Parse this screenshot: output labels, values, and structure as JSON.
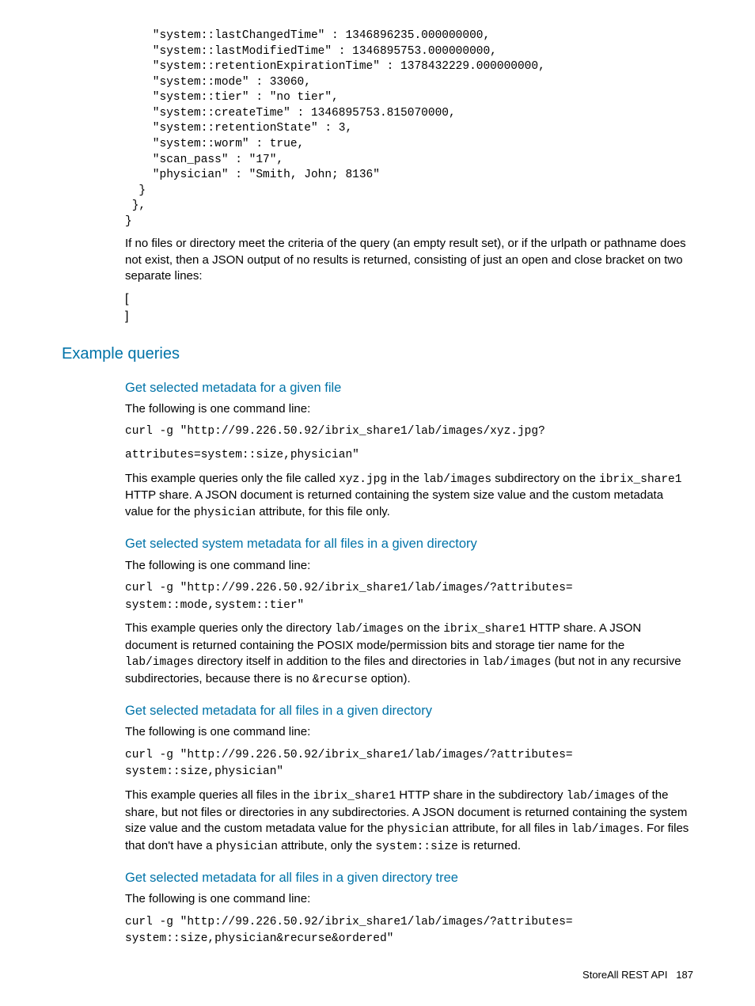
{
  "code_top": "    \"system::lastChangedTime\" : 1346896235.000000000,\n    \"system::lastModifiedTime\" : 1346895753.000000000,\n    \"system::retentionExpirationTime\" : 1378432229.000000000,\n    \"system::mode\" : 33060,\n    \"system::tier\" : \"no tier\",\n    \"system::createTime\" : 1346895753.815070000,\n    \"system::retentionState\" : 3,\n    \"system::worm\" : true,\n    \"scan_pass\" : \"17\",\n    \"physician\" : \"Smith, John; 8136\"\n  }\n },\n}",
  "para_empty": "If no files or directory meet the criteria of the query (an empty result set), or if the urlpath or pathname does not exist, then a JSON output of no results is returned, consisting of just an open and close bracket on two separate lines:",
  "bracket_open": "[",
  "bracket_close": "]",
  "section_examples": "Example queries",
  "ex1": {
    "title": "Get selected metadata for a given file",
    "intro": "The following is one command line:",
    "cmd1": "curl -g \"http://99.226.50.92/ibrix_share1/lab/images/xyz.jpg?",
    "cmd2": "attributes=system::size,physician\"",
    "desc_pre": "This example queries only the file called ",
    "code_a": "xyz.jpg",
    "desc_mid1": " in the ",
    "code_b": "lab/images",
    "desc_mid2": " subdirectory on the ",
    "code_c": "ibrix_share1",
    "desc_mid3": " HTTP share. A JSON document is returned containing the system size value and the custom metadata value for the ",
    "code_d": "physician",
    "desc_end": " attribute, for this file only."
  },
  "ex2": {
    "title": "Get selected system metadata for all files in a given directory",
    "intro": "The following is one command line:",
    "cmd": "curl -g \"http://99.226.50.92/ibrix_share1/lab/images/?attributes=\nsystem::mode,system::tier\"",
    "desc_pre": "This example queries only the directory ",
    "code_a": "lab/images",
    "desc_mid1": " on the ",
    "code_b": "ibrix_share1",
    "desc_mid2": " HTTP share. A JSON document is returned containing the POSIX mode/permission bits and storage tier name for the ",
    "code_c": "lab/images",
    "desc_mid3": " directory itself in addition to the files and directories in ",
    "code_d": "lab/images",
    "desc_mid4": " (but not in any recursive subdirectories, because there is no ",
    "code_e": "&recurse",
    "desc_end": " option)."
  },
  "ex3": {
    "title": "Get selected metadata for all files in a given directory",
    "intro": "The following is one command line:",
    "cmd": "curl -g \"http://99.226.50.92/ibrix_share1/lab/images/?attributes=\nsystem::size,physician\"",
    "desc_pre": "This example queries all files in the ",
    "code_a": "ibrix_share1",
    "desc_mid1": " HTTP share in the subdirectory ",
    "code_b": "lab/images",
    "desc_mid2": " of the share, but not files or directories in any subdirectories. A JSON document is returned containing the system size value and the custom metadata value for the ",
    "code_c": "physician",
    "desc_mid3": " attribute, for all files in ",
    "code_d": "lab/images",
    "desc_mid4": ". For files that don't have a ",
    "code_e": "physician",
    "desc_mid5": " attribute, only the ",
    "code_f": "system::size",
    "desc_end": " is returned."
  },
  "ex4": {
    "title": "Get selected metadata for all files in a given directory tree",
    "intro": "The following is one command line:",
    "cmd": "curl -g \"http://99.226.50.92/ibrix_share1/lab/images/?attributes=\nsystem::size,physician&recurse&ordered\""
  },
  "footer_label": "StoreAll REST API",
  "footer_page": "187"
}
